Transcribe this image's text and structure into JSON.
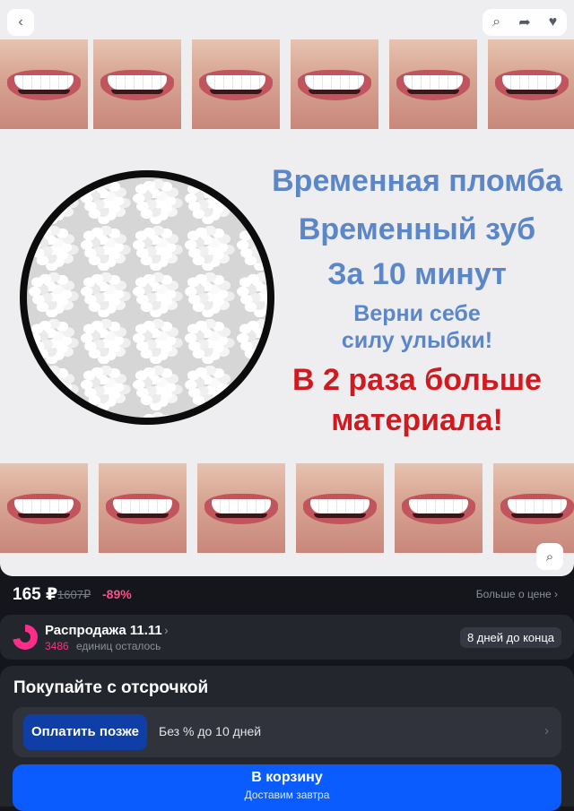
{
  "icons": {
    "back": "‹",
    "search": "⌕",
    "share": "➦",
    "favorite": "♥",
    "image_search": "⌕"
  },
  "promo": {
    "line1": "Временная пломба",
    "line2": "Временный зуб",
    "line3": "За 10 минут",
    "line4": "Верни себе",
    "line5": "силу улыбки!",
    "line6": "В 2 раза больше",
    "line7": "материала!"
  },
  "price": {
    "current": "165 ₽",
    "old": "1607₽",
    "discount": "-89%",
    "more": "Больше о цене ›"
  },
  "sale": {
    "title": "Распродажа 11.11",
    "chevron": "›",
    "count": "3486",
    "left_text": "единиц осталось",
    "days": "8 дней до конца"
  },
  "payment": {
    "title": "Покупайте с отсрочкой",
    "pay_later": "Оплатить позже",
    "description": "Без % до 10 дней",
    "chevron": "›"
  },
  "cart": {
    "label": "В корзину",
    "sublabel": "Доставим завтра"
  },
  "colors": {
    "promo_blue": "#5b86c8",
    "promo_red": "#d11a1f",
    "discount": "#ff4f8a",
    "sale_accent": "#ff2d8a",
    "cart_button": "#0b5cff",
    "pay_later_button": "#0e3ea6"
  }
}
